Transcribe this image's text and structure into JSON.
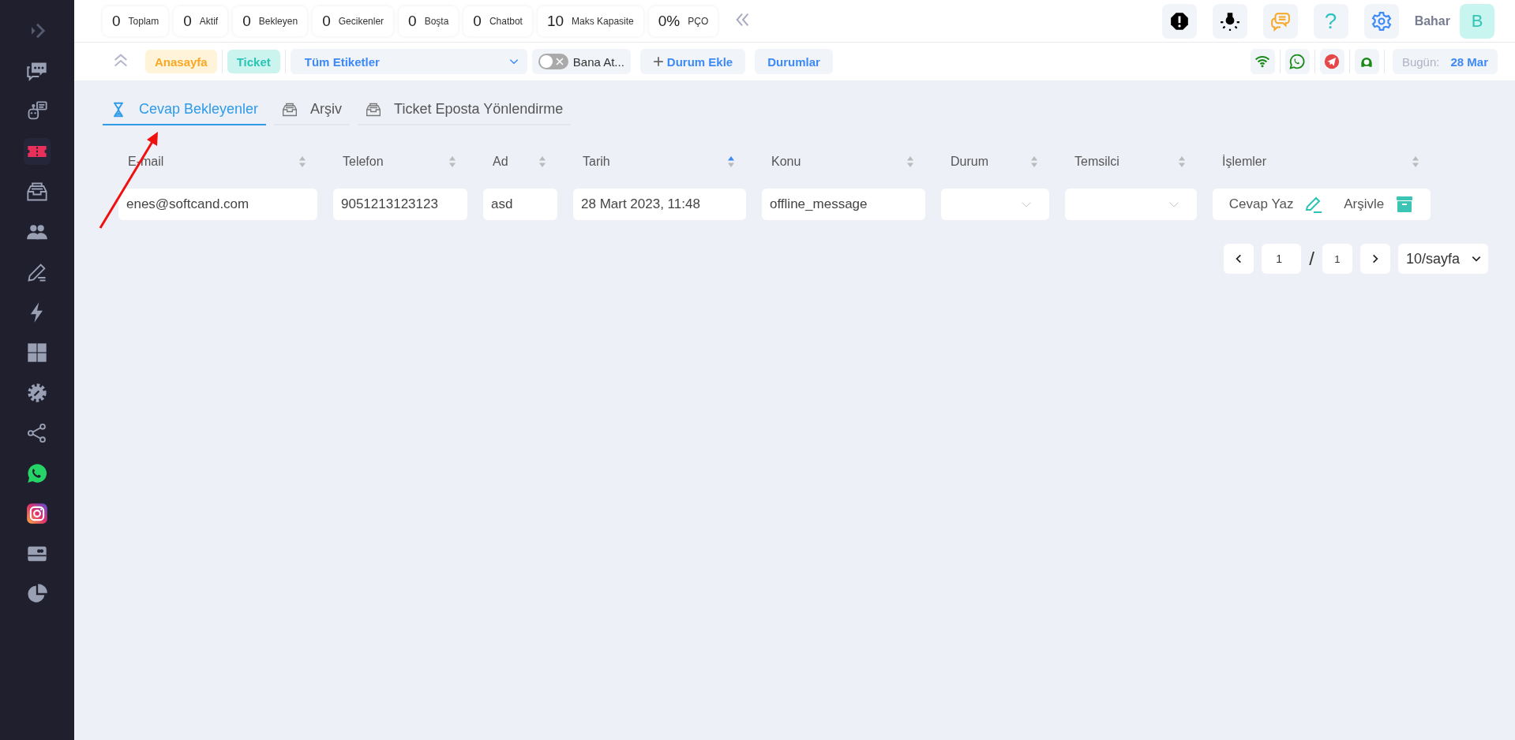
{
  "sidebar": {
    "items": [
      {
        "kind": "expand",
        "selected": false
      },
      {
        "kind": "chat",
        "selected": false
      },
      {
        "kind": "bot",
        "selected": false
      },
      {
        "kind": "ticket",
        "selected": true
      },
      {
        "kind": "archive",
        "selected": false
      },
      {
        "kind": "users",
        "selected": false
      },
      {
        "kind": "edit",
        "selected": false
      },
      {
        "kind": "bolt",
        "selected": false
      },
      {
        "kind": "grid",
        "selected": false
      },
      {
        "kind": "gear",
        "selected": false
      },
      {
        "kind": "share",
        "selected": false
      },
      {
        "kind": "whatsapp",
        "selected": false
      },
      {
        "kind": "instagram",
        "selected": false
      },
      {
        "kind": "card",
        "selected": false
      },
      {
        "kind": "pie",
        "selected": false
      }
    ]
  },
  "stats": [
    {
      "value": "0",
      "label": "Toplam"
    },
    {
      "value": "0",
      "label": "Aktif"
    },
    {
      "value": "0",
      "label": "Bekleyen"
    },
    {
      "value": "0",
      "label": "Gecikenler"
    },
    {
      "value": "0",
      "label": "Boşta"
    },
    {
      "value": "0",
      "label": "Chatbot"
    },
    {
      "value": "10",
      "label": "Maks Kapasite"
    },
    {
      "value": "0%",
      "label": "PÇO"
    }
  ],
  "header_tools": [
    {
      "kind": "alert"
    },
    {
      "kind": "bulb"
    },
    {
      "kind": "chat"
    },
    {
      "kind": "help",
      "glyph": "?"
    },
    {
      "kind": "settings"
    }
  ],
  "user": {
    "name": "Bahar",
    "initial": "B"
  },
  "toolbar": {
    "breadcrumbs": [
      {
        "label": "Anasayfa",
        "kind": "home"
      },
      {
        "label": "Ticket",
        "kind": "current"
      }
    ],
    "tag_filter": "Tüm Etiketler",
    "assign_toggle": {
      "label": "Bana At...",
      "on": false
    },
    "buttons": [
      {
        "label": "Durum Ekle",
        "kind": "add"
      },
      {
        "label": "Durumlar",
        "kind": "plain"
      }
    ],
    "channels": [
      {
        "kind": "wifi"
      },
      {
        "kind": "whatsapp"
      },
      {
        "kind": "telegram"
      },
      {
        "kind": "agent"
      }
    ],
    "today_label": "Bugün:",
    "today_value": "28 Mar"
  },
  "tabs": [
    {
      "label": "Cevap Bekleyenler",
      "kind": "hourglass",
      "selected": true
    },
    {
      "label": "Arşiv",
      "kind": "tray",
      "selected": false
    },
    {
      "label": "Ticket Eposta Yönlendirme",
      "kind": "tray",
      "selected": false
    }
  ],
  "table": {
    "columns": [
      {
        "label": "E-mail",
        "sorted": false
      },
      {
        "label": "Telefon",
        "sorted": false
      },
      {
        "label": "Ad",
        "sorted": false
      },
      {
        "label": "Tarih",
        "sorted": true
      },
      {
        "label": "Konu",
        "sorted": false
      },
      {
        "label": "Durum",
        "sorted": false
      },
      {
        "label": "Temsilci",
        "sorted": false
      },
      {
        "label": "İşlemler",
        "sorted": false
      }
    ],
    "rows": [
      [
        {
          "kind": "text",
          "value": "enes@softcand.com"
        },
        {
          "kind": "text",
          "value": "9051213123123"
        },
        {
          "kind": "text",
          "value": "asd"
        },
        {
          "kind": "text",
          "value": "28 Mart 2023, 11:48"
        },
        {
          "kind": "text",
          "value": "offline_message"
        },
        {
          "kind": "select"
        },
        {
          "kind": "select"
        },
        {
          "kind": "actions",
          "actions": [
            {
              "label": "Cevap Yaz",
              "kind": "reply"
            },
            {
              "label": "Arşivle",
              "kind": "archive"
            }
          ]
        }
      ]
    ]
  },
  "pagination": {
    "page": "1",
    "separator": "/",
    "total": "1",
    "per_page": "10/sayfa"
  },
  "annotations": [
    {
      "kind": "arrow"
    }
  ]
}
